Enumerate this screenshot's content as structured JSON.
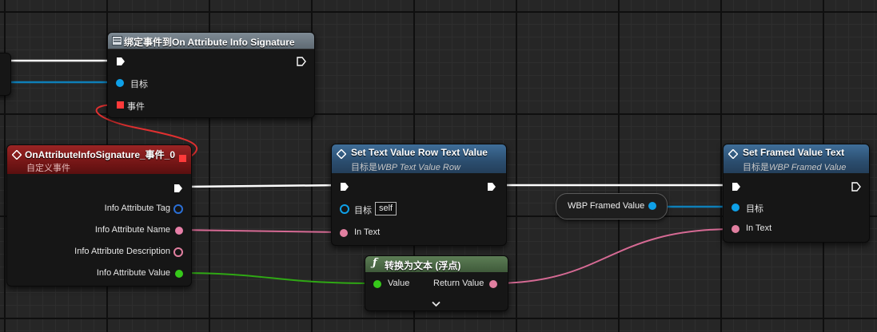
{
  "nodes": {
    "bind_event": {
      "title": "绑定事件到On Attribute Info Signature",
      "pin_target": "目标",
      "pin_event": "事件"
    },
    "custom_event": {
      "title": "OnAttributeInfoSignature_事件_0",
      "subtitle": "自定义事件",
      "pins": [
        "Info Attribute Tag",
        "Info Attribute Name",
        "Info Attribute Description",
        "Info Attribute Value"
      ]
    },
    "set_text_row": {
      "title": "Set Text Value Row Text Value",
      "subtitle_prefix": "目标是",
      "subtitle_class": "WBP Text Value Row",
      "pin_target": "目标",
      "target_value": "self",
      "pin_in_text": "In Text"
    },
    "set_framed": {
      "title": "Set Framed Value Text",
      "subtitle_prefix": "目标是",
      "subtitle_class": "WBP Framed Value",
      "pin_target": "目标",
      "pin_in_text": "In Text"
    },
    "framed_var": {
      "label": "WBP Framed Value"
    },
    "to_text": {
      "title": "转换为文本 (浮点)",
      "pin_value": "Value",
      "pin_return": "Return Value"
    }
  },
  "colors": {
    "exec": "#ffffff",
    "object_ref": "#0ea0e8",
    "gameplay_tag": "#2a6fd6",
    "string": "#e77fa8",
    "text": "#e17fa0",
    "float": "#36c81a",
    "delegate": "#ff3a3a"
  },
  "icons": {
    "bind_event": "event-dispatcher-icon",
    "functions": "function-diamond-icon",
    "pure_function": "f-function-icon",
    "expand": "chevron-down-icon"
  }
}
